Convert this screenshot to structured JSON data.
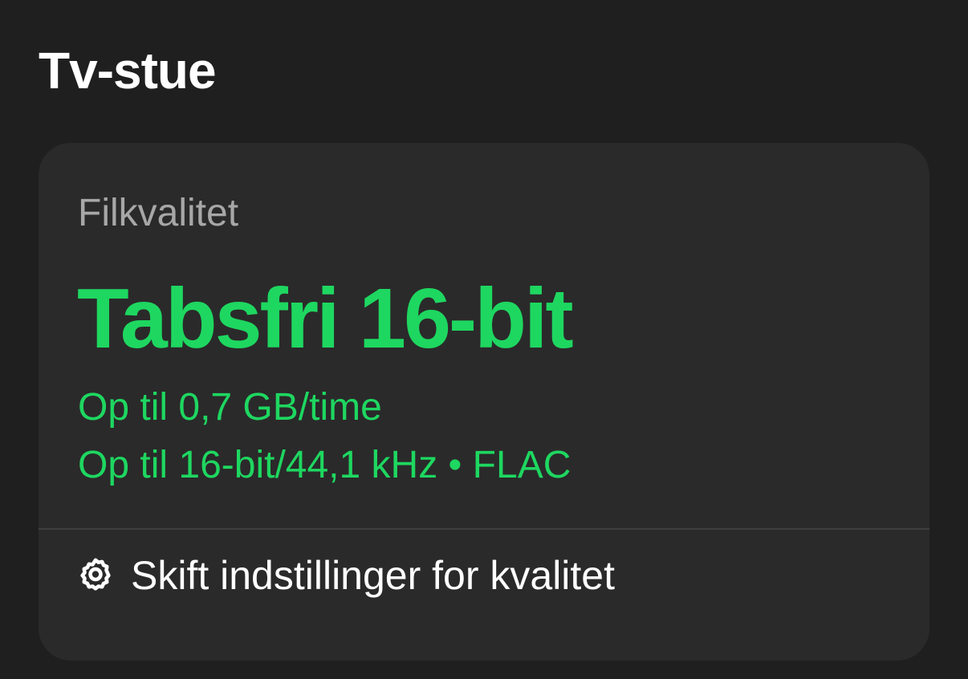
{
  "header": {
    "device_name": "Tv-stue"
  },
  "quality_card": {
    "label": "Filkvalitet",
    "quality": "Tabsfri 16-bit",
    "data_usage": "Op til 0,7 GB/time",
    "format_info": "Op til 16-bit/44,1 kHz • FLAC",
    "settings_link": {
      "icon": "gear-icon",
      "label": "Skift indstillinger for kvalitet"
    }
  },
  "colors": {
    "background": "#1f1f1f",
    "card": "#2a2a2a",
    "accent_green": "#1ed760",
    "secondary_text": "#a7a7a7",
    "primary_text": "#ffffff"
  }
}
